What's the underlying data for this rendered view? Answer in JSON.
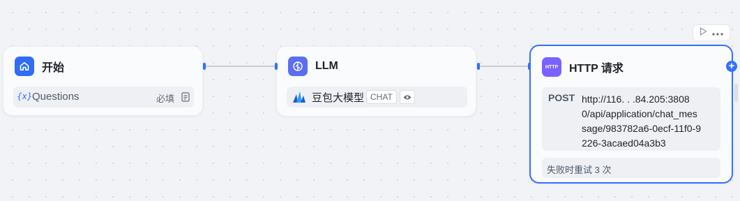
{
  "start_node": {
    "title": "开始",
    "param": {
      "icon_text": "{x}",
      "name": "Questions",
      "required": "必填"
    }
  },
  "llm_node": {
    "title": "LLM",
    "model": {
      "name": "豆包大模型",
      "tag": "CHAT"
    }
  },
  "http_node": {
    "title": "HTTP 请求",
    "icon_text": "HTTP",
    "method": "POST",
    "url_lines": [
      "http://116.  .   .84.205:3808",
      "0/api/application/chat_mes",
      "sage/983782a6-0ecf-11f0-9",
      "226-3acaed04a3b3"
    ],
    "retry": "失败时重试 3 次"
  },
  "colors": {
    "accent": "#3370ff",
    "http_icon": "#7b61ff",
    "llm_icon": "#5b6ef0",
    "start_icon": "#2f6df6"
  }
}
